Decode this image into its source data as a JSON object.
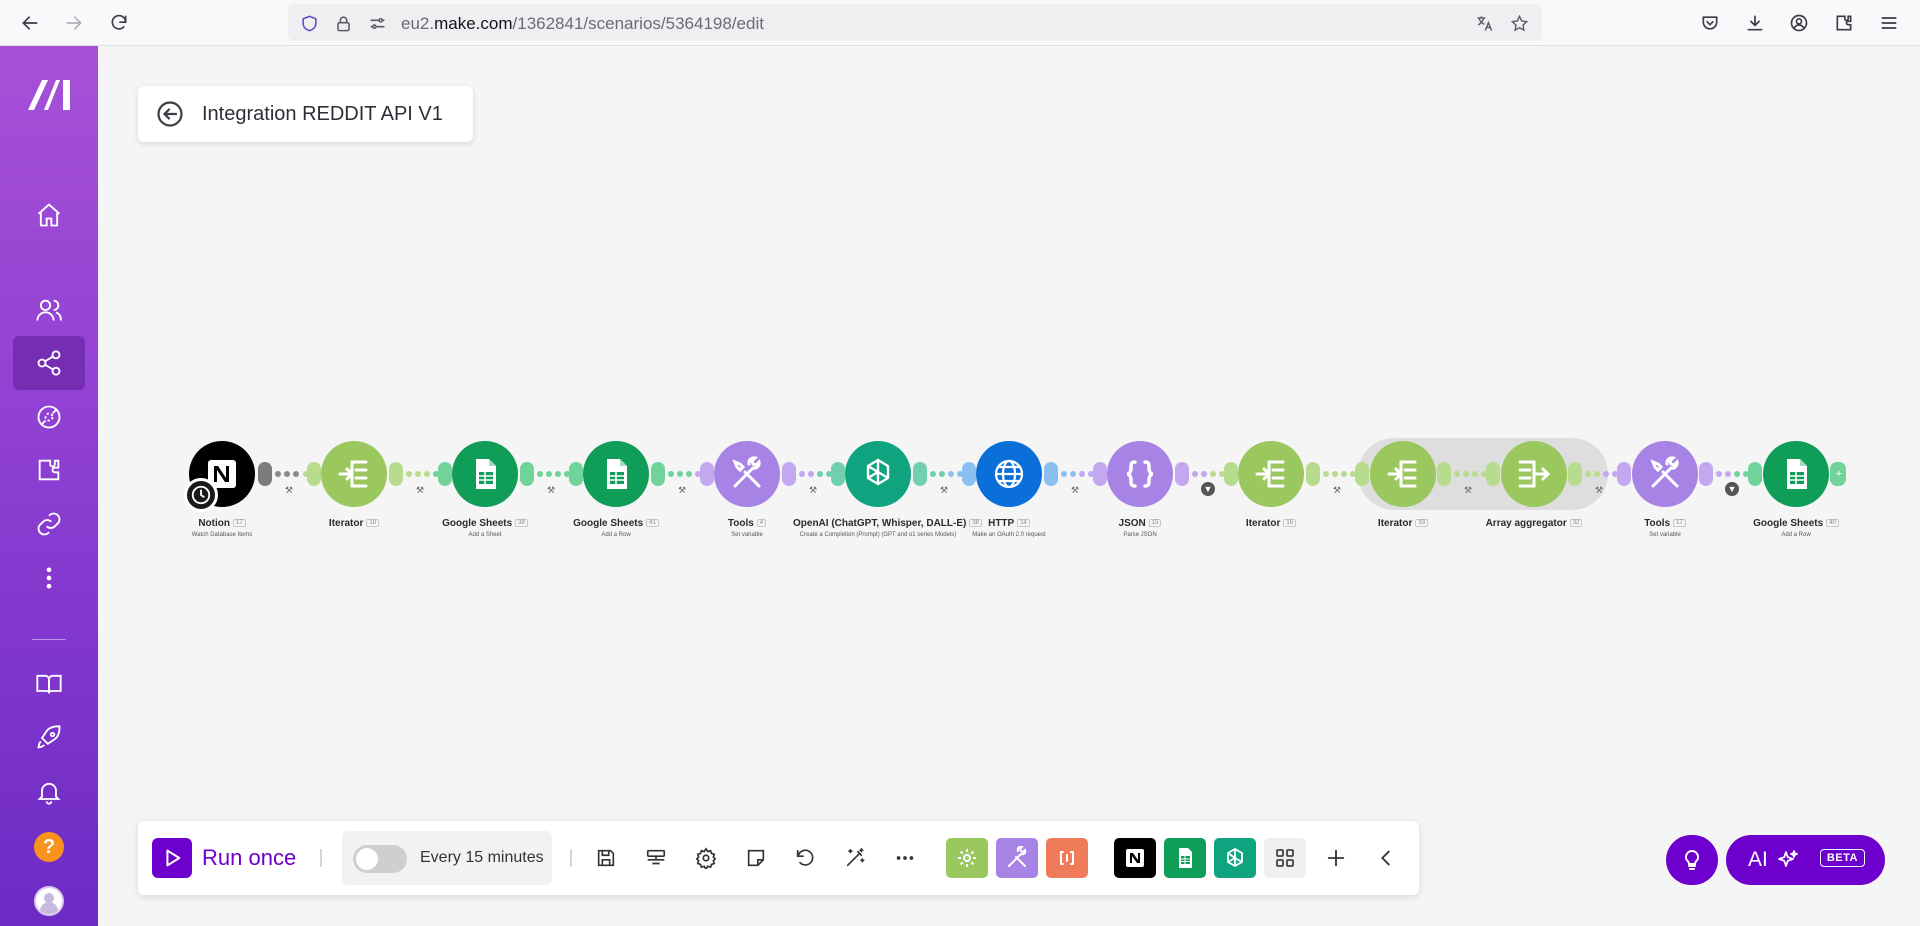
{
  "browser": {
    "url_prefix": "eu2.",
    "url_domain": "make.com",
    "url_path": "/1362841/scenarios/5364198/edit"
  },
  "scenario": {
    "title": "Integration REDDIT API V1"
  },
  "modules": [
    {
      "name": "Notion",
      "num": "17",
      "sub": "Watch Database Items",
      "color": "#000000",
      "icon": "notion-icon"
    },
    {
      "name": "Iterator",
      "num": "18",
      "sub": "",
      "color": "#9ac85f",
      "icon": "iterator-icon"
    },
    {
      "name": "Google Sheets",
      "num": "38",
      "sub": "Add a Sheet",
      "color": "#0f9d58",
      "icon": "google-sheets-icon"
    },
    {
      "name": "Google Sheets",
      "num": "41",
      "sub": "Add a Row",
      "color": "#0f9d58",
      "icon": "google-sheets-icon"
    },
    {
      "name": "Tools",
      "num": "4",
      "sub": "Set variable",
      "color": "#a883e6",
      "icon": "tools-icon"
    },
    {
      "name": "OpenAI (ChatGPT, Whisper, DALL-E)",
      "num": "38",
      "sub": "Create a Completion (Prompt) (GPT and o1 series Models)",
      "color": "#10a37f",
      "icon": "openai-icon"
    },
    {
      "name": "HTTP",
      "num": "14",
      "sub": "Make an OAuth 2.0 request",
      "color": "#0a6fd8",
      "icon": "globe-icon"
    },
    {
      "name": "JSON",
      "num": "15",
      "sub": "Parse JSON",
      "color": "#a883e6",
      "icon": "json-icon"
    },
    {
      "name": "Iterator",
      "num": "16",
      "sub": "",
      "color": "#9ac85f",
      "icon": "iterator-icon"
    },
    {
      "name": "Iterator",
      "num": "33",
      "sub": "",
      "color": "#9ac85f",
      "icon": "iterator-icon"
    },
    {
      "name": "Array aggregator",
      "num": "32",
      "sub": "",
      "color": "#9ac85f",
      "icon": "aggregator-icon"
    },
    {
      "name": "Tools",
      "num": "17",
      "sub": "Set variable",
      "color": "#a883e6",
      "icon": "tools-icon"
    },
    {
      "name": "Google Sheets",
      "num": "40",
      "sub": "Add a Row",
      "color": "#0f9d58",
      "icon": "google-sheets-icon"
    }
  ],
  "toolbar": {
    "run_once_label": "Run once",
    "schedule_label": "Every 15 minutes",
    "schedule_enabled": false
  },
  "ai_button": {
    "label": "AI",
    "badge": "BETA"
  },
  "colors": {
    "brand_purple": "#6d00cc",
    "sidebar_top": "#a651d6",
    "sidebar_bottom": "#6d2bc4"
  }
}
